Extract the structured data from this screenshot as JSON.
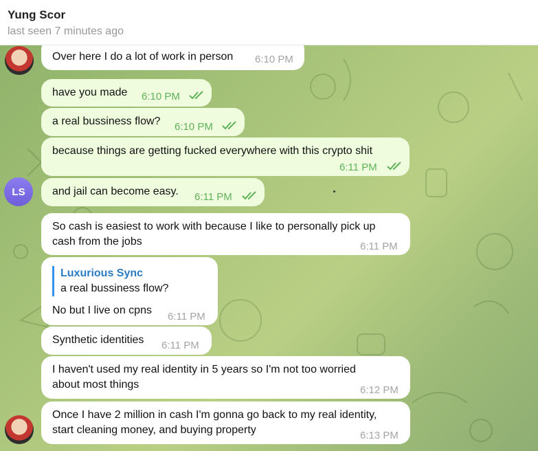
{
  "header": {
    "name": "Yung Scor",
    "status": "last seen 7 minutes ago"
  },
  "avatar_ls": {
    "initials": "LS"
  },
  "messages": [
    {
      "text": "Over here I do a lot of work in person",
      "time": "6:10 PM"
    },
    {
      "text": "have you made",
      "time": "6:10 PM"
    },
    {
      "text": "a real bussiness flow?",
      "time": "6:10 PM"
    },
    {
      "text": "because things are getting fucked everywhere with this crypto shit",
      "time": "6:11 PM"
    },
    {
      "text": "and jail can become easy.",
      "time": "6:11 PM"
    },
    {
      "text": "So cash is easiest to work with because I like to personally pick up\ncash from the jobs",
      "time": "6:11 PM"
    },
    {
      "reply_name": "Luxurious Sync",
      "reply_text": "a real bussiness flow?",
      "text": "No but I live on cpns",
      "time": "6:11 PM"
    },
    {
      "text": "Synthetic identities",
      "time": "6:11 PM"
    },
    {
      "text": "I haven't used my real identity in 5 years so I'm not too worried\nabout most things",
      "time": "6:12 PM"
    },
    {
      "text": "Once I have 2 million in cash I'm gonna go back to my real identity,\nstart cleaning money, and buying property",
      "time": "6:13 PM"
    }
  ],
  "colors": {
    "outgoing_bubble": "#effdde",
    "incoming_bubble": "#ffffff",
    "outgoing_time": "#5fb15a",
    "incoming_time": "#a4a4a4",
    "reply_accent": "#3390ec",
    "avatar_ls": "#7b6ce6"
  }
}
